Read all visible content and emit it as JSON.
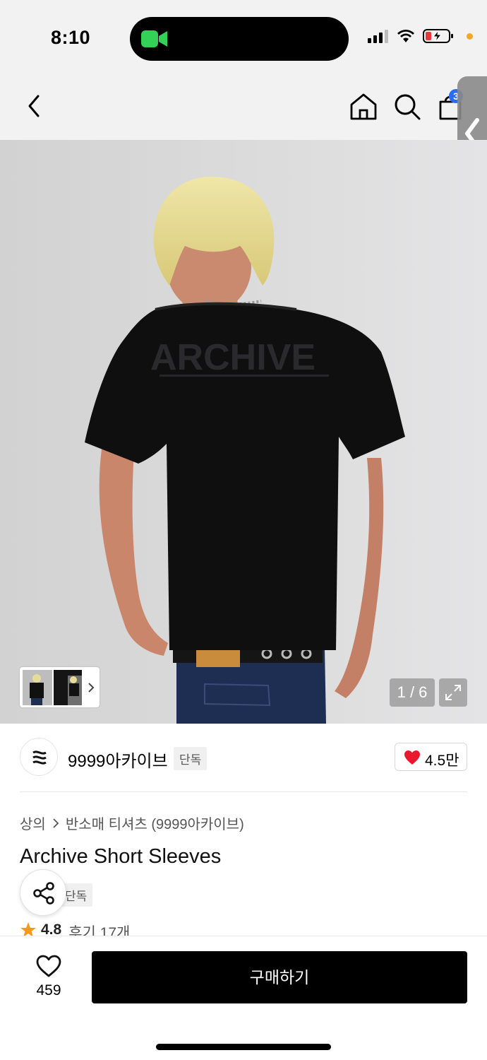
{
  "status_bar": {
    "time": "8:10"
  },
  "header": {
    "cart_count": "3"
  },
  "gallery": {
    "page_indicator": "1 / 6",
    "print_text": "ARCHIVE"
  },
  "brand": {
    "name": "9999아카이브",
    "tag": "단독",
    "likes": "4.5만"
  },
  "product": {
    "breadcrumb": [
      "상의",
      "반소매 티셔츠 (9999아카이브)"
    ],
    "title": "Archive Short Sleeves",
    "tag": "단독",
    "rating": "4.8",
    "review_label": "후기 17개"
  },
  "bottom_bar": {
    "wish_count": "459",
    "buy_label": "구매하기"
  },
  "colors": {
    "accent_like": "#e8192c",
    "cart_badge": "#2b6cf6",
    "star": "#f39a1c"
  }
}
